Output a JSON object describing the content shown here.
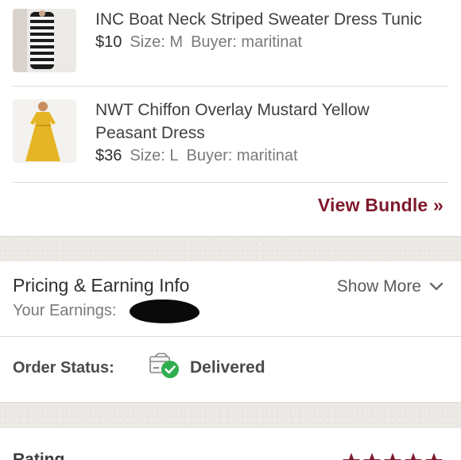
{
  "items": [
    {
      "title": "INC Boat Neck Striped Sweater Dress Tunic",
      "price": "$10",
      "size": "Size: M",
      "buyer": "Buyer: maritinat",
      "thumbnail_icon": "striped-dress-photo"
    },
    {
      "title": "NWT Chiffon Overlay Mustard Yellow Peasant Dress",
      "price": "$36",
      "size": "Size: L",
      "buyer": "Buyer: maritinat",
      "thumbnail_icon": "yellow-dress-photo"
    }
  ],
  "view_bundle": "View Bundle »",
  "pricing": {
    "title": "Pricing & Earning Info",
    "show_more": "Show More",
    "earnings_label": "Your Earnings:"
  },
  "order": {
    "label": "Order Status:",
    "value": "Delivered",
    "icon": "package-delivered-icon"
  },
  "bottom": {
    "label": "Rating",
    "stars": 5
  },
  "colors": {
    "accent": "#7f1a2c",
    "success": "#2eae4e",
    "band": "#ece9e5"
  }
}
